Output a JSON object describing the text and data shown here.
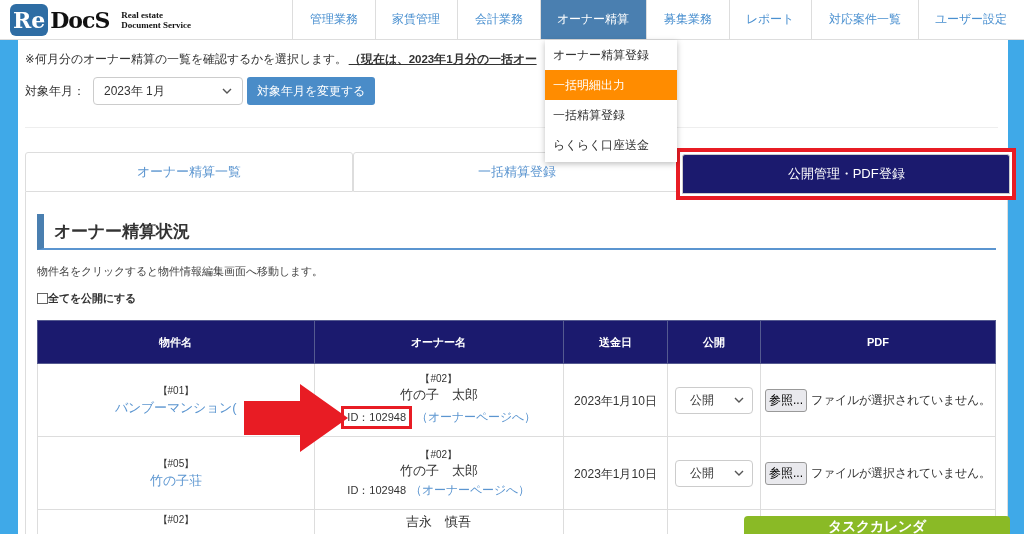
{
  "header": {
    "logo_mark": "Re",
    "logo_word": "DocS",
    "tagline": [
      "Real estate",
      "Document Service"
    ],
    "nav": [
      {
        "label": "管理業務",
        "selected": false
      },
      {
        "label": "家賃管理",
        "selected": false
      },
      {
        "label": "会計業務",
        "selected": false
      },
      {
        "label": "オーナー精算",
        "selected": true
      },
      {
        "label": "募集業務",
        "selected": false
      },
      {
        "label": "レポート",
        "selected": false
      },
      {
        "label": "対応案件一覧",
        "selected": false
      },
      {
        "label": "ユーザー設定",
        "selected": false
      }
    ]
  },
  "dropdown": [
    {
      "label": "オーナー精算登録",
      "selected": false
    },
    {
      "label": "一括明細出力",
      "selected": true
    },
    {
      "label": "一括精算登録",
      "selected": false
    },
    {
      "label": "らくらく口座送金",
      "selected": false
    }
  ],
  "notice": {
    "text": "※何月分のオーナー精算の一覧を確認するかを選択します。",
    "emphasis": "（現在は、2023年1月分の一括オー"
  },
  "period": {
    "label": "対象年月：",
    "value": "2023年 1月",
    "button": "対象年月を変更する"
  },
  "tabs": [
    {
      "label": "オーナー精算一覧",
      "selected": false,
      "highlighted": false
    },
    {
      "label": "一括精算登録",
      "selected": false,
      "highlighted": false
    },
    {
      "label": "公開管理・PDF登録",
      "selected": true,
      "highlighted": true
    }
  ],
  "section": {
    "heading": "オーナー精算状況",
    "hint": "物件名をクリックすると物件情報編集画面へ移動します。",
    "publish_all": {
      "label": "全てを公開にする",
      "checked": false
    }
  },
  "table": {
    "columns": [
      "物件名",
      "オーナー名",
      "送金日",
      "公開",
      "PDF"
    ],
    "rows": [
      {
        "property_no": "【#01】",
        "property_name": "バンブーマンション(",
        "owner_no": "【#02】",
        "owner_name": "竹の子　太郎",
        "owner_id": "ID：102948",
        "id_highlighted": true,
        "owner_link": "（オーナーページへ）",
        "date": "2023年1月10日",
        "visibility": "公開",
        "file_button": "参照...",
        "file_status": "ファイルが選択されていません。"
      },
      {
        "property_no": "【#05】",
        "property_name": "竹の子荘",
        "owner_no": "【#02】",
        "owner_name": "竹の子　太郎",
        "owner_id": "ID：102948",
        "id_highlighted": false,
        "owner_link": "（オーナーページへ）",
        "date": "2023年1月10日",
        "visibility": "公開",
        "file_button": "参照...",
        "file_status": "ファイルが選択されていません。"
      },
      {
        "property_no": "【#02】",
        "owner_name": "吉永　慎吾"
      }
    ]
  },
  "floating_button": "タスクカレンダ",
  "annotations": [
    {
      "kind": "arrow"
    }
  ]
}
